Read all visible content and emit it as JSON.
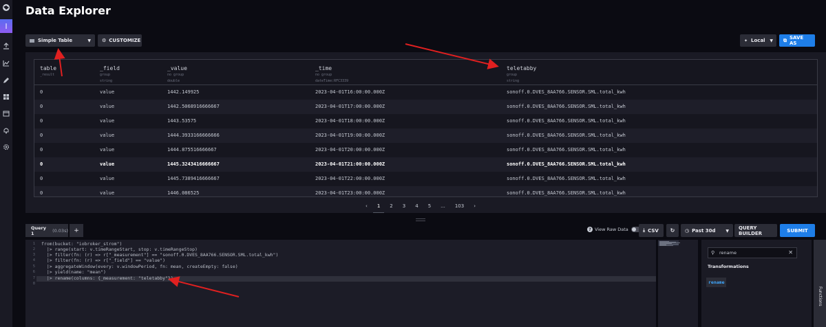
{
  "page": {
    "title": "Data Explorer"
  },
  "nav": {
    "items": [
      "logo-icon",
      "data-explorer-icon",
      "upload-icon",
      "chart-icon",
      "pencil-icon",
      "dashboard-icon",
      "calendar-icon",
      "bell-icon",
      "gear-icon"
    ]
  },
  "toolbar": {
    "vis_type": "Simple Table",
    "customize": "CUSTOMIZE",
    "timezone": "Local",
    "save_as": "SAVE AS"
  },
  "table": {
    "columns": [
      {
        "name": "table",
        "meta1": "_result",
        "meta2": ""
      },
      {
        "name": "_field",
        "meta1": "group",
        "meta2": "string"
      },
      {
        "name": "_value",
        "meta1": "no group",
        "meta2": "double"
      },
      {
        "name": "_time",
        "meta1": "no group",
        "meta2": "dateTime:RFC3339"
      },
      {
        "name": "teletabby",
        "meta1": "group",
        "meta2": "string"
      }
    ],
    "rows": [
      [
        "0",
        "value",
        "1442.149925",
        "2023-04-01T16:00:00.000Z",
        "sonoff.0.DVES_8AA766.SENSOR.SML.total_kwh"
      ],
      [
        "0",
        "value",
        "1442.5068916666667",
        "2023-04-01T17:00:00.000Z",
        "sonoff.0.DVES_8AA766.SENSOR.SML.total_kwh"
      ],
      [
        "0",
        "value",
        "1443.53575",
        "2023-04-01T18:00:00.000Z",
        "sonoff.0.DVES_8AA766.SENSOR.SML.total_kwh"
      ],
      [
        "0",
        "value",
        "1444.3933166666666",
        "2023-04-01T19:00:00.000Z",
        "sonoff.0.DVES_8AA766.SENSOR.SML.total_kwh"
      ],
      [
        "0",
        "value",
        "1444.875516666667",
        "2023-04-01T20:00:00.000Z",
        "sonoff.0.DVES_8AA766.SENSOR.SML.total_kwh"
      ],
      [
        "0",
        "value",
        "1445.3243416666667",
        "2023-04-01T21:00:00.000Z",
        "sonoff.0.DVES_8AA766.SENSOR.SML.total_kwh"
      ],
      [
        "0",
        "value",
        "1445.7389416666667",
        "2023-04-01T22:00:00.000Z",
        "sonoff.0.DVES_8AA766.SENSOR.SML.total_kwh"
      ],
      [
        "0",
        "value",
        "1446.086525",
        "2023-04-01T23:00:00.000Z",
        "sonoff.0.DVES_8AA766.SENSOR.SML.total_kwh"
      ]
    ],
    "pagination": {
      "prev": "‹",
      "pages": [
        "1",
        "2",
        "3",
        "4",
        "5"
      ],
      "ellipsis": "...",
      "last": "103",
      "next": "›",
      "current": "1"
    }
  },
  "query": {
    "tab_label": "Query 1",
    "tab_time": "(0.03s)",
    "add_label": "+",
    "raw_data_label": "View Raw Data",
    "csv_label": "CSV",
    "range_label": "Past 30d",
    "query_builder_label": "QUERY BUILDER",
    "submit_label": "SUBMIT"
  },
  "editor": {
    "line_numbers": [
      "1",
      "2",
      "3",
      "4",
      "5",
      "6",
      "7",
      "8"
    ],
    "lines": [
      "from(bucket: \"iobroker_strom\")",
      "  |> range(start: v.timeRangeStart, stop: v.timeRangeStop)",
      "  |> filter(fn: (r) => r[\"_measurement\"] == \"sonoff.0.DVES_8AA766.SENSOR.SML.total_kwh\")",
      "  |> filter(fn: (r) => r[\"_field\"] == \"value\")",
      "  |> aggregateWindow(every: v.windowPeriod, fn: mean, createEmpty: false)",
      "  |> yield(name: \"mean\")",
      "  |> rename(columns: {_measurement: \"teletabby\"})",
      ""
    ]
  },
  "functions": {
    "search_value": "rename",
    "section_title": "Transformations",
    "items": [
      "rename"
    ],
    "tab_label": "Functions"
  },
  "colors": {
    "accent_blue": "#1e7ee8",
    "annotation_red": "#e02020",
    "background": "#0b0b12"
  }
}
